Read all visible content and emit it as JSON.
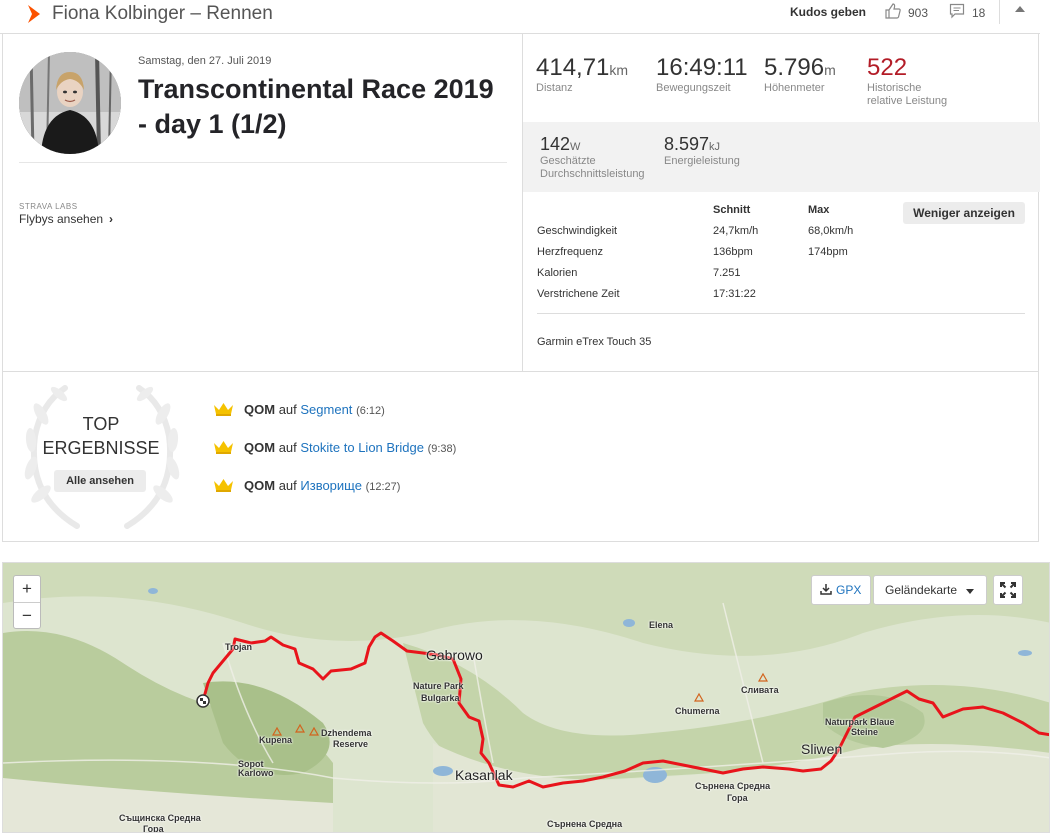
{
  "header": {
    "title": "Fiona Kolbinger – Rennen",
    "kudos_label": "Kudos geben",
    "kudos_count": "903",
    "comment_count": "18"
  },
  "activity": {
    "date": "Samstag, den 27. Juli 2019",
    "title": "Transcontinental Race 2019 - day 1 (1/2)",
    "labs_label": "STRAVA LABS",
    "flybys_label": "Flybys ansehen"
  },
  "stats": {
    "primary": [
      {
        "value": "414,71",
        "unit": "km",
        "label": "Distanz"
      },
      {
        "value": "16:49:11",
        "unit": "",
        "label": "Bewegungszeit"
      },
      {
        "value": "5.796",
        "unit": "m",
        "label": "Höhenmeter"
      },
      {
        "value": "522",
        "unit": "",
        "label_line1": "Historische",
        "label_line2": "relative Leistung"
      }
    ],
    "secondary": [
      {
        "value": "142",
        "unit": "W",
        "label_line1": "Geschätzte",
        "label_line2": "Durchschnittsleistung"
      },
      {
        "value": "8.597",
        "unit": "kJ",
        "label": "Energieleistung"
      }
    ]
  },
  "table": {
    "col_avg": "Schnitt",
    "col_max": "Max",
    "less_button": "Weniger anzeigen",
    "rows": [
      {
        "label": "Geschwindigkeit",
        "avg": "24,7km/h",
        "max": "68,0km/h"
      },
      {
        "label": "Herzfrequenz",
        "avg": "136bpm",
        "max": "174bpm"
      },
      {
        "label": "Kalorien",
        "avg": "7.251",
        "max": ""
      },
      {
        "label": "Verstrichene Zeit",
        "avg": "17:31:22",
        "max": ""
      }
    ],
    "device": "Garmin eTrex Touch 35"
  },
  "top_results": {
    "title_line1": "TOP",
    "title_line2": "ERGEBNISSE",
    "all_button": "Alle ansehen",
    "items": [
      {
        "badge": "QOM",
        "prefix": "auf",
        "segment": "Segment",
        "time": "(6:12)"
      },
      {
        "badge": "QOM",
        "prefix": "auf",
        "segment": "Stokite to Lion Bridge",
        "time": "(9:38)"
      },
      {
        "badge": "QOM",
        "prefix": "auf",
        "segment": "Изворище",
        "time": "(12:27)"
      }
    ]
  },
  "map": {
    "zoom_in": "+",
    "zoom_out": "−",
    "gpx_label": "GPX",
    "terrain_label": "Geländekarte",
    "places": {
      "troyan": "Trojan",
      "gabrovo": "Gabrowo",
      "nature_park": "Nature Park",
      "bulgarka": "Bulgarka",
      "elena": "Elena",
      "slivata": "Сливата",
      "chumerna": "Chumerna",
      "kupena": "Kupena",
      "dzhendema": "Dzhendema",
      "reserve": "Reserve",
      "sopot": "Sopot",
      "karlovo": "Karlowo",
      "kazanlak": "Kasanlak",
      "sliven": "Sliwen",
      "blue_stones_1": "Naturpark Blaue",
      "blue_stones_2": "Steine",
      "sarnena_1": "Сърнена Средна",
      "sarnena_2": "Гора",
      "sashtinska_1": "Същинска Средна",
      "sashtinska_2": "Гора",
      "sarnena_bottom": "Сърнена Средна"
    },
    "colors": {
      "route": "#e8141b",
      "relief": "#c3d2ae",
      "water": "#8fb6d8"
    }
  }
}
